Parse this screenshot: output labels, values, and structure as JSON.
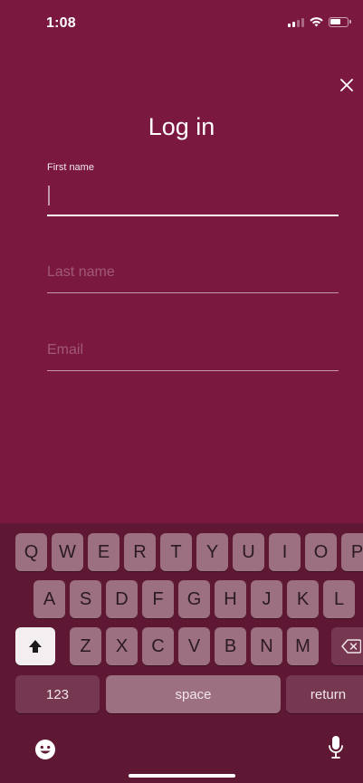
{
  "status_bar": {
    "time": "1:08"
  },
  "header": {
    "title": "Log in"
  },
  "form": {
    "first_name": {
      "label": "First name",
      "value": "",
      "placeholder": ""
    },
    "last_name": {
      "placeholder": "Last name",
      "value": ""
    },
    "email": {
      "placeholder": "Email",
      "value": ""
    }
  },
  "keyboard": {
    "row1": [
      "Q",
      "W",
      "E",
      "R",
      "T",
      "Y",
      "U",
      "I",
      "O",
      "P"
    ],
    "row2": [
      "A",
      "S",
      "D",
      "F",
      "G",
      "H",
      "J",
      "K",
      "L"
    ],
    "row3": [
      "Z",
      "X",
      "C",
      "V",
      "B",
      "N",
      "M"
    ],
    "numbers_label": "123",
    "space_label": "space",
    "return_label": "return"
  },
  "icons": {
    "close": "close-icon",
    "shift": "shift-icon",
    "delete": "delete-icon",
    "emoji": "emoji-icon",
    "mic": "microphone-icon"
  },
  "colors": {
    "background": "#7b1840",
    "keyboard_background": "#5f1834",
    "underline": "#ffffff"
  }
}
